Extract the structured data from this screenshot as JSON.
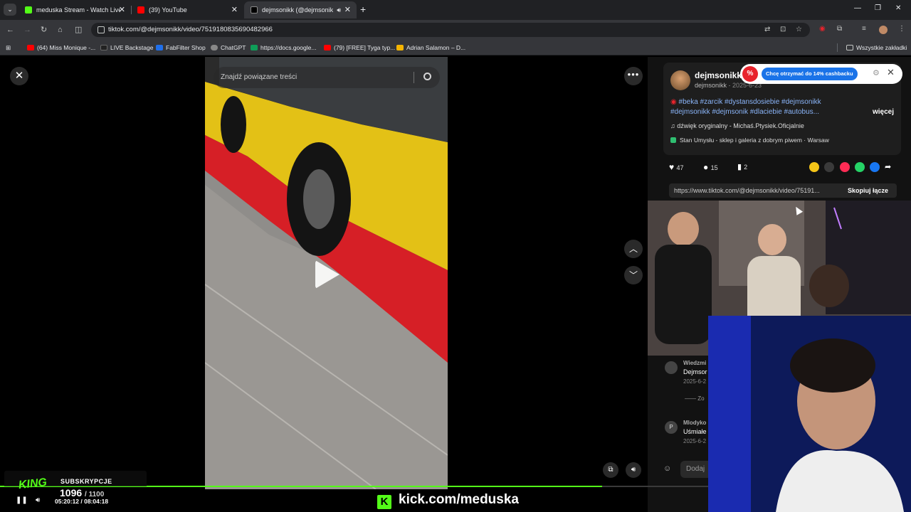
{
  "browser": {
    "tabs": [
      {
        "title": "meduska Stream - Watch Live o",
        "favicon_color": "#53fc18",
        "active": false
      },
      {
        "title": "(39) YouTube",
        "favicon_color": "#ff0000",
        "active": false
      },
      {
        "title": "dejmsonikk (@dejmsonikk)",
        "favicon_color": "#000000",
        "active": true
      }
    ],
    "tab_close_glyph": "✕",
    "url": "tiktok.com/@dejmsonikk/video/7519180835690482966",
    "bookmarks": [
      {
        "label": "(64) Miss Monique -...",
        "icon_color": "#ff0000"
      },
      {
        "label": "LIVE Backstage",
        "icon_color": "#222222"
      },
      {
        "label": "FabFilter Shop",
        "icon_color": "#1f6feb"
      },
      {
        "label": "ChatGPT",
        "icon_color": "#888888"
      },
      {
        "label": "https://docs.google...",
        "icon_color": "#0f9d58"
      },
      {
        "label": "(79) [FREE] Tyga typ...",
        "icon_color": "#ff0000"
      },
      {
        "label": "Adrian Salamon – D...",
        "icon_color": "#f4b400"
      }
    ],
    "all_bookmarks": "Wszystkie zakładki"
  },
  "tiktok": {
    "search_placeholder": "Znajdź powiązane treści",
    "author": {
      "name": "dejmsonikk",
      "handle": "dejmsonikk",
      "date": "2025-6-23"
    },
    "tags_line1": "#beka #zarcik #dystansdosiebie #dejmsonikk",
    "tags_line2": "#dejmsonikk #dejmsonik #dlaciebie #autobus...",
    "more_label": "więcej",
    "music": "dźwięk oryginalny - Michaś.Ptysiek.Oficjalnie",
    "location": "Stan Umysłu - sklep i galeria z dobrym piwem · Warsaw",
    "likes": "47",
    "comments": "15",
    "saves": "2",
    "share_colors": [
      "#f5c518",
      "#3a3a3a",
      "#fe2c55",
      "#25d366",
      "#1877f2"
    ],
    "copy_url": "https://www.tiktok.com/@dejmsonikk/video/75191...",
    "copy_label": "Skopiuj łącze",
    "comment_list": [
      {
        "avatar": "",
        "name": "Wiedzmi",
        "text": "Dejmsor",
        "date": "2025-6-2"
      },
      {
        "avatar": "P",
        "name": "Mlodyko",
        "text": "Uśmiałe",
        "date": "2025-6-2"
      }
    ],
    "view_replies": "Zo",
    "comment_placeholder": "Dodaj"
  },
  "extension": {
    "cashback_label": "Chcę otrzymać do 14% cashbacku"
  },
  "stream_overlay": {
    "subs_label": "SUBSKRYPCJE",
    "subs_count": "1096",
    "subs_goal": "/ 1100",
    "time": "05:20:12 / 08:04:18",
    "progress": 0.85,
    "kick_text": "kick.com/meduska",
    "logo_text": "KING"
  }
}
